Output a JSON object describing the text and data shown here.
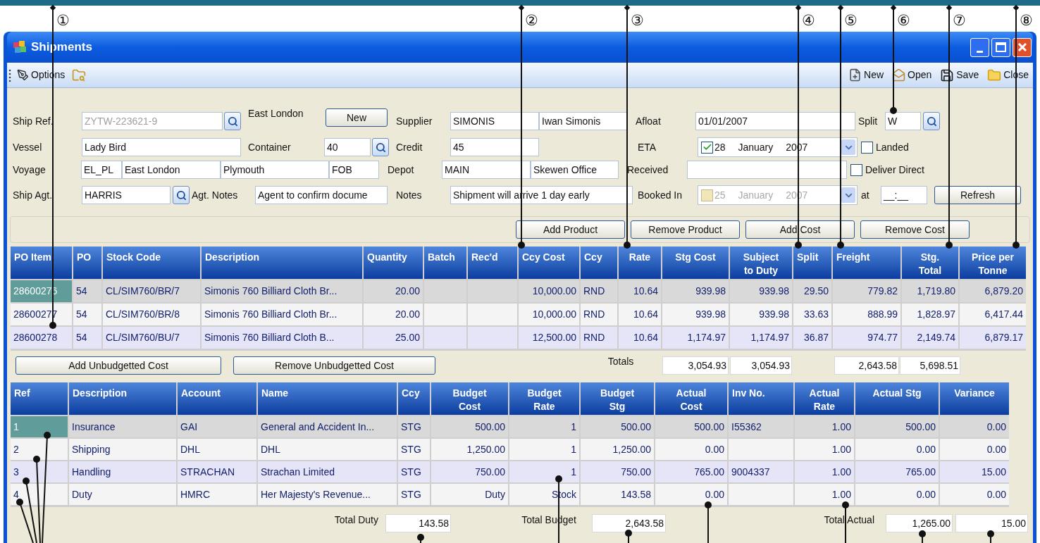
{
  "callouts": [
    {
      "label": "①"
    },
    {
      "label": "②"
    },
    {
      "label": "③"
    },
    {
      "label": "④"
    },
    {
      "label": "⑤"
    },
    {
      "label": "⑥"
    },
    {
      "label": "⑦"
    },
    {
      "label": "⑧"
    }
  ],
  "window": {
    "title": "Shipments"
  },
  "toolbar": {
    "left": [
      {
        "label": "Options"
      }
    ],
    "right": [
      {
        "label": "New"
      },
      {
        "label": "Open"
      },
      {
        "label": "Save"
      },
      {
        "label": "Close"
      }
    ]
  },
  "form": {
    "ship_ref": {
      "label": "Ship Ref.",
      "value": "ZYTW-223621-9",
      "disabled": true
    },
    "port_note": "East London",
    "new_button": "New",
    "vessel": {
      "label": "Vessel",
      "value": "Lady Bird"
    },
    "container": {
      "label": "Container",
      "value": "40"
    },
    "voyage": {
      "label": "Voyage",
      "values": [
        "EL_PL",
        "East London",
        "Plymouth",
        "FOB"
      ]
    },
    "ship_agent": {
      "label": "Ship Agt.",
      "value": "HARRIS"
    },
    "agent_notes": {
      "label": "Agt. Notes",
      "value": "Agent to confirm docume"
    },
    "supplier": {
      "label": "Supplier",
      "values": [
        "SIMONIS",
        "Iwan Simonis"
      ]
    },
    "credit": {
      "label": "Credit",
      "value": "45"
    },
    "depot": {
      "label": "Depot",
      "values": [
        "MAIN",
        "Skewen Office"
      ]
    },
    "notes": {
      "label": "Notes",
      "value": "Shipment will arrive 1 day early"
    },
    "afloat": {
      "label": "Afloat",
      "value": "01/01/2007"
    },
    "eta": {
      "label": "ETA",
      "checked": true,
      "disabled": false,
      "value": "28 January 2007"
    },
    "received": {
      "label": "Received"
    },
    "booked_in": {
      "label": "Booked In",
      "checked": false,
      "disabled": true,
      "value": "25 January 2007"
    },
    "split": {
      "label": "Split",
      "value": "W"
    },
    "landed": {
      "label": "Landed",
      "checked": false
    },
    "deliver_direct": {
      "label": "Deliver Direct",
      "checked": false
    },
    "at": {
      "label": "at",
      "value": "__:__"
    },
    "refresh_button": "Refresh"
  },
  "action_buttons": [
    "Add Product",
    "Remove Product",
    "Add Cost",
    "Remove Cost"
  ],
  "products": {
    "columns": [
      "PO Item",
      "PO",
      "Stock Code",
      "Description",
      "Quantity",
      "Batch",
      "Rec'd",
      "Ccy Cost",
      "Ccy",
      "Rate",
      "Stg Cost",
      "Subject\nto Duty",
      "Split",
      "Freight",
      "Stg.\nTotal",
      "Price per\nTonne"
    ],
    "rows": [
      {
        "selected": true,
        "cells": [
          "28600276",
          "54",
          "CL/SIM760/BR/7",
          "Simonis 760 Billiard Cloth Br...",
          "20.00",
          null,
          null,
          "10,000.00",
          "RND",
          "10.64",
          "939.98",
          "939.98",
          "29.50",
          "779.82",
          "1,719.80",
          "6,879.20"
        ]
      },
      {
        "selected": false,
        "cells": [
          "28600277",
          "54",
          "CL/SIM760/BR/8",
          "Simonis 760 Billiard Cloth Br...",
          "20.00",
          null,
          null,
          "10,000.00",
          "RND",
          "10.64",
          "939.98",
          "939.98",
          "33.63",
          "888.99",
          "1,828.97",
          "6,417.44"
        ]
      },
      {
        "selected": false,
        "cells": [
          "28600278",
          "54",
          "CL/SIM760/BU/7",
          "Simonis 760 Billiard Cloth B...",
          "25.00",
          null,
          null,
          "12,500.00",
          "RND",
          "10.64",
          "1,174.97",
          "1,174.97",
          "36.87",
          "974.77",
          "2,149.74",
          "6,879.17"
        ]
      }
    ],
    "totals": {
      "label": "Totals",
      "stg_cost": "3,054.93",
      "subject_to_duty": "3,054.93",
      "freight": "2,643.58",
      "stg_total": "5,698.51"
    }
  },
  "cost_buttons": [
    "Add Unbudgetted Cost",
    "Remove Unbudgetted Cost"
  ],
  "costs": {
    "columns": [
      "Ref",
      "Description",
      "Account",
      "Name",
      "Ccy",
      "Budget\nCost",
      "Budget\nRate",
      "Budget\nStg",
      "Actual\nCost",
      "Inv No.",
      "Actual\nRate",
      "Actual Stg",
      "Variance"
    ],
    "rows": [
      {
        "selected": true,
        "cells": [
          "1",
          "Insurance",
          "GAI",
          "General and Accident In...",
          "STG",
          "500.00",
          "1",
          "500.00",
          "500.00",
          "I55362",
          "1.00",
          "500.00",
          "0.00"
        ]
      },
      {
        "selected": false,
        "cells": [
          "2",
          "Shipping",
          "DHL",
          "DHL",
          "STG",
          "1,250.00",
          "1",
          "1,250.00",
          "0.00",
          null,
          "1.00",
          "0.00",
          "0.00"
        ]
      },
      {
        "selected": false,
        "cells": [
          "3",
          "Handling",
          "STRACHAN",
          "Strachan Limited",
          "STG",
          "750.00",
          "1",
          "750.00",
          "765.00",
          "9004337",
          "1.00",
          "765.00",
          "15.00"
        ]
      },
      {
        "selected": false,
        "cells": [
          "4",
          "Duty",
          "HMRC",
          "Her Majesty's Revenue...",
          "STG",
          "Duty",
          "Stock",
          "143.58",
          "0.00",
          null,
          "1.00",
          "0.00",
          "0.00"
        ]
      }
    ],
    "totals": {
      "duty_label": "Total Duty",
      "duty": "143.58",
      "budget_label": "Total Budget",
      "budget": "2,643.58",
      "actual_label": "Total Actual",
      "actual": "1,265.00",
      "variance": "15.00"
    }
  }
}
